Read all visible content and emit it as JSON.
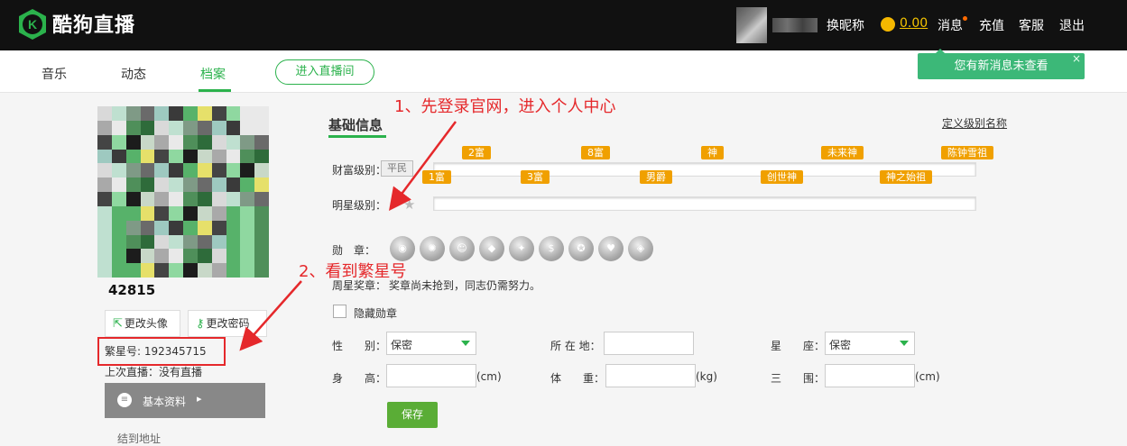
{
  "colors": {
    "accent": "#2bb24c",
    "annotation": "#e5282b",
    "topbar": "#111111",
    "badge": "#f0a000",
    "toast": "#3cb878"
  },
  "header": {
    "logo_text": "酷狗直播",
    "nav": {
      "nickname": "换昵称",
      "balance": "0.00",
      "messages": "消息",
      "recharge": "充值",
      "service": "客服",
      "logout": "退出"
    }
  },
  "tabs": [
    {
      "label": "音乐"
    },
    {
      "label": "动态"
    },
    {
      "label": "档案",
      "active": true
    }
  ],
  "enter_live_label": "进入直播间",
  "toast": {
    "text": "您有新消息未查看",
    "close": "×"
  },
  "profile": {
    "uid": "42815",
    "change_avatar": "更改头像",
    "change_password": "更改密码",
    "fanxing_label": "繁星号:",
    "fanxing_number": "192345715",
    "last_live": "上次直播：没有直播",
    "menu_basic": "基本资料",
    "menu_next": "结到地址"
  },
  "basic": {
    "title": "基础信息",
    "define_link": "定义级别名称",
    "wealth_label": "财富级别：",
    "wealth_current": "平民",
    "wealth_badges_top": [
      "2富",
      "8富",
      "神",
      "未来神",
      "陈钟雪祖"
    ],
    "wealth_badges_bottom": [
      "1富",
      "3富",
      "男爵",
      "创世神",
      "神之始祖"
    ],
    "star_label": "明星级别：",
    "medal_label": "勋　章：",
    "weekly_label": "周星奖章：",
    "weekly_text": "奖章尚未抢到，同志仍需努力。",
    "hide_medal": "隐藏勋章",
    "form": {
      "gender_label": "性　　别：",
      "gender_value": "保密",
      "location_label": "所 在 地：",
      "constellation_label": "星　　座：",
      "constellation_value": "保密",
      "height_label": "身　　高：",
      "height_unit": "(cm)",
      "weight_label": "体　　重：",
      "weight_unit": "(kg)",
      "measure_label": "三　　围：",
      "measure_unit": "(cm)"
    },
    "save_label": "保存"
  },
  "annotations": {
    "step1": "1、先登录官网，进入个人中心",
    "step2": "2、看到繁星号"
  }
}
